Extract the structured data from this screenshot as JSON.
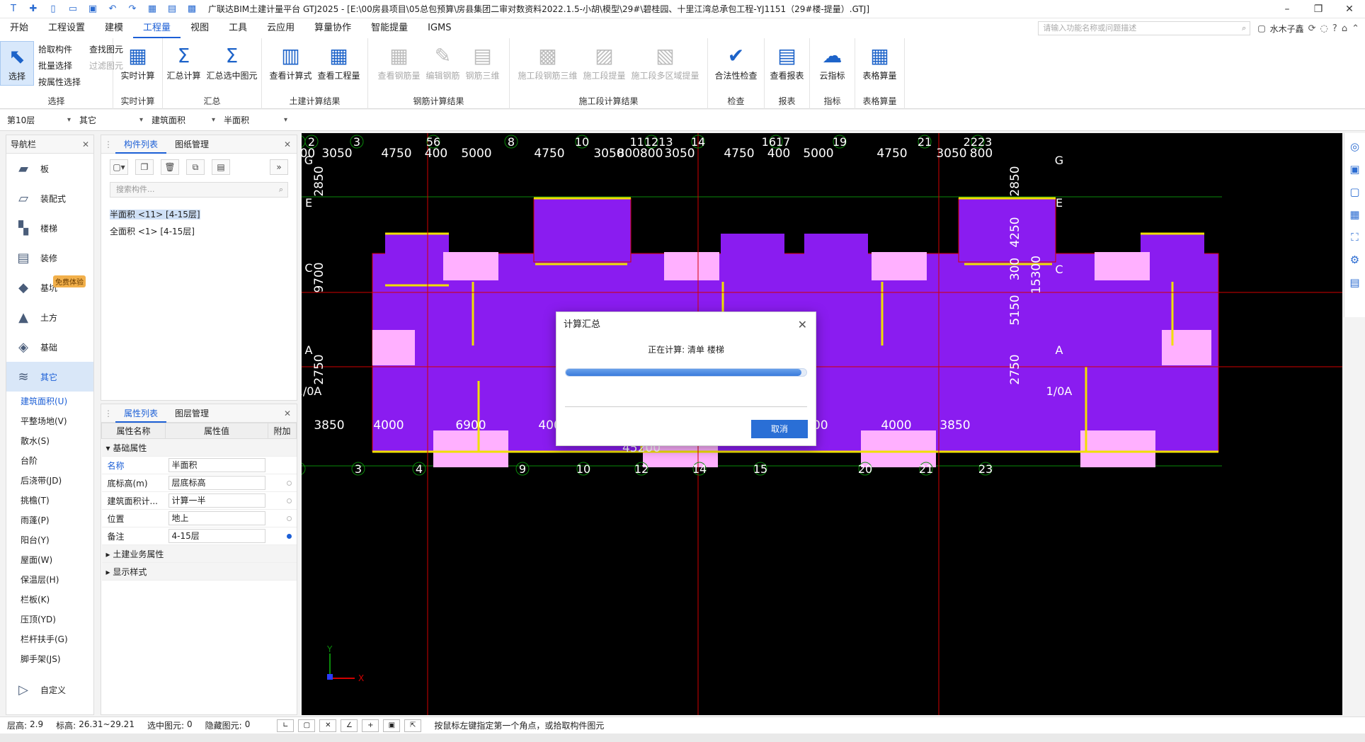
{
  "title": "广联达BIM土建计量平台 GTJ2025 - [E:\\00房县项目\\05总包预算\\房县集团二审对数资料2022.1.5-小胡\\模型\\29#\\碧桂园、十里江湾总承包工程-YJ1151（29#楼-提量）.GTJ]",
  "menu": [
    "开始",
    "工程设置",
    "建模",
    "工程量",
    "视图",
    "工具",
    "云应用",
    "算量协作",
    "智能提量",
    "IGMS"
  ],
  "menu_active": "工程量",
  "search_placeholder": "请输入功能名称或问题描述",
  "user": "水木子鑫",
  "ribbon": {
    "select": {
      "label": "选择",
      "big": "选择",
      "items": [
        "拾取构件",
        "批量选择",
        "按属性选择"
      ],
      "items2": [
        "查找图元",
        "过滤图元"
      ]
    },
    "realtime": {
      "label": "实时计算",
      "btn": "实时计算"
    },
    "summary": {
      "label": "汇总",
      "btns": [
        "汇总计算",
        "汇总选中图元"
      ]
    },
    "civil": {
      "label": "土建计算结果",
      "btns": [
        "查看计算式",
        "查看工程量"
      ]
    },
    "rebar": {
      "label": "钢筋计算结果",
      "btns": [
        "查看钢筋量",
        "编辑钢筋",
        "钢筋三维"
      ]
    },
    "stage": {
      "label": "施工段计算结果",
      "btns": [
        "施工段钢筋三维",
        "施工段提量",
        "施工段多区域提量"
      ]
    },
    "check": {
      "label": "检查",
      "btn": "合法性检查"
    },
    "report": {
      "label": "报表",
      "btn": "查看报表"
    },
    "index": {
      "label": "指标",
      "btn": "云指标"
    },
    "table": {
      "label": "表格算量",
      "btn": "表格算量"
    }
  },
  "filters": [
    "第10层",
    "其它",
    "建筑面积",
    "半面积"
  ],
  "nav": {
    "title": "导航栏",
    "items": [
      "板",
      "装配式",
      "楼梯",
      "装修",
      "基坑",
      "土方",
      "基础",
      "其它"
    ],
    "badge": "免费体验",
    "subs": [
      "建筑面积(U)",
      "平整场地(V)",
      "散水(S)",
      "台阶",
      "后浇带(JD)",
      "挑檐(T)",
      "雨蓬(P)",
      "阳台(Y)",
      "屋面(W)",
      "保温层(H)",
      "栏板(K)",
      "压顶(YD)",
      "栏杆扶手(G)",
      "脚手架(JS)"
    ],
    "custom": "自定义"
  },
  "component_panel": {
    "tabs": [
      "构件列表",
      "图纸管理"
    ],
    "search": "搜索构件...",
    "items": [
      "半面积 <11> [4-15层]",
      "全面积 <1> [4-15层]"
    ]
  },
  "property_panel": {
    "tabs": [
      "属性列表",
      "图层管理"
    ],
    "headers": [
      "属性名称",
      "属性值",
      "附加"
    ],
    "section": "基础属性",
    "rows": [
      {
        "name": "名称",
        "value": "半面积"
      },
      {
        "name": "底标高(m)",
        "value": "层底标高"
      },
      {
        "name": "建筑面积计...",
        "value": "计算一半"
      },
      {
        "name": "位置",
        "value": "地上"
      },
      {
        "name": "备注",
        "value": "4-15层"
      }
    ],
    "sections2": [
      "土建业务属性",
      "显示样式"
    ]
  },
  "cad": {
    "top_axes": [
      "1",
      "2",
      "3",
      "56",
      "8",
      "10",
      "111213",
      "14",
      "1617",
      "19",
      "21",
      "2223"
    ],
    "top_dims": [
      "800",
      "3050",
      "4750",
      "400",
      "5000",
      "4750",
      "3050",
      "800800",
      "3050",
      "4750",
      "400",
      "5000",
      "4750",
      "3050",
      "800"
    ],
    "left_axes": [
      "G",
      "E",
      "C",
      "A",
      "1/0A"
    ],
    "left_dims": [
      "2850",
      "9700",
      "2750"
    ],
    "right_dims": [
      "2850",
      "4250",
      "300",
      "5150",
      "2750",
      "15300"
    ],
    "bottom_dims": [
      "3850",
      "4000",
      "6900",
      "4000",
      "3850",
      "3850",
      "4000",
      "6900",
      "4000",
      "3850"
    ],
    "total": "45200",
    "bottom_axes": [
      "1",
      "3",
      "4",
      "9",
      "10",
      "12",
      "14",
      "15",
      "20",
      "21",
      "23"
    ],
    "ucs_x": "X",
    "ucs_y": "Y",
    "colors": {
      "floor": "#8a1cf0",
      "wall": "#f0e000",
      "pink": "#ffb0ff",
      "grid": "#0a8a0a",
      "red": "#d20000"
    }
  },
  "dialog": {
    "title": "计算汇总",
    "message": "正在计算: 清单 楼梯",
    "progress": 0.98,
    "cancel": "取消"
  },
  "status": {
    "floor_height_label": "层高:",
    "floor_height": "2.9",
    "elev_label": "标高:",
    "elev": "26.31~29.21",
    "selected_label": "选中图元:",
    "selected": "0",
    "hidden_label": "隐藏图元:",
    "hidden": "0",
    "hint": "按鼠标左键指定第一个角点，或拾取构件图元"
  }
}
